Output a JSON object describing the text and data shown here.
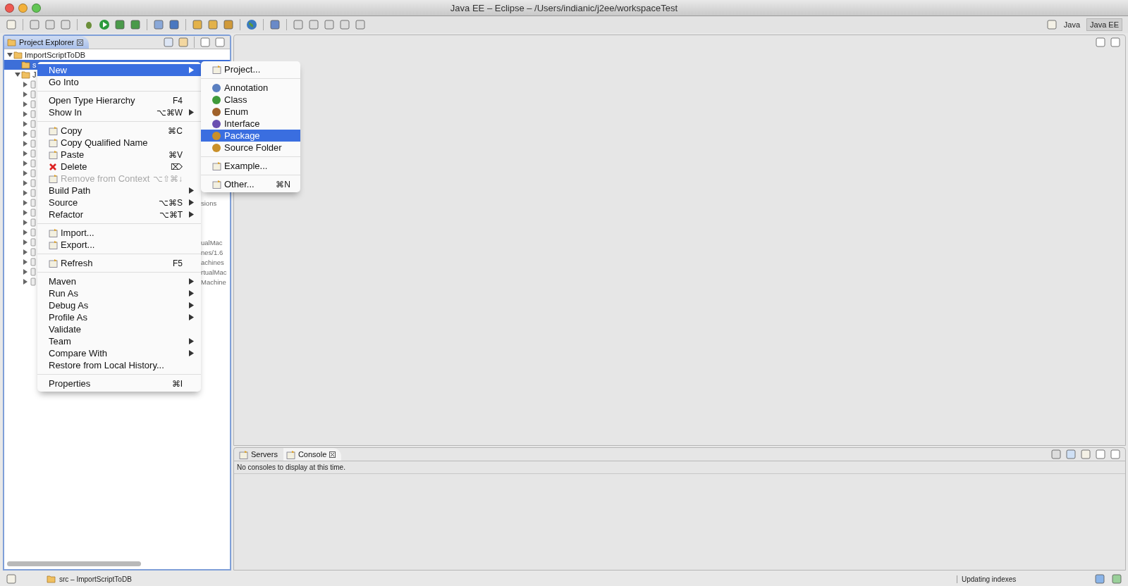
{
  "window": {
    "title": "Java EE – Eclipse – /Users/indianic/j2ee/workspaceTest"
  },
  "perspectives": [
    {
      "label": "Java",
      "selected": false
    },
    {
      "label": "Java EE",
      "selected": true
    }
  ],
  "project_explorer": {
    "tab": {
      "label": "Project Explorer",
      "selected": true
    },
    "tree": [
      {
        "label": "ImportScriptToDB",
        "expanded": true,
        "selected": false,
        "children": [
          {
            "label": "s",
            "selected": true
          },
          {
            "label": "J",
            "expanded": true,
            "selected": false,
            "children": [
              {
                "expanded": false
              },
              {
                "expanded": false
              },
              {
                "expanded": false
              },
              {
                "expanded": false
              },
              {
                "expanded": false
              },
              {
                "expanded": false
              },
              {
                "expanded": false
              },
              {
                "expanded": false
              },
              {
                "expanded": false
              },
              {
                "expanded": false
              },
              {
                "expanded": false
              },
              {
                "expanded": false
              },
              {
                "expanded": false,
                "label": "sions"
              },
              {
                "expanded": false
              },
              {
                "expanded": false
              },
              {
                "expanded": false
              },
              {
                "expanded": false,
                "label": "ualMac"
              },
              {
                "expanded": false,
                "label": "nes/1.6"
              },
              {
                "expanded": false,
                "label": "achines"
              },
              {
                "expanded": false,
                "label": "rtualMac"
              },
              {
                "expanded": false,
                "label": "Machine"
              }
            ]
          }
        ]
      }
    ]
  },
  "context_menu": {
    "items": [
      {
        "kind": "item",
        "label": "New",
        "submenu": true,
        "selected": true,
        "disabled": false
      },
      {
        "kind": "item",
        "label": "Go Into",
        "submenu": false,
        "selected": false,
        "disabled": false
      },
      {
        "kind": "separator"
      },
      {
        "kind": "item",
        "label": "Open Type Hierarchy",
        "shortcut": "F4",
        "submenu": false,
        "selected": false,
        "disabled": false
      },
      {
        "kind": "item",
        "label": "Show In",
        "shortcut": "⌥⌘W",
        "submenu": true,
        "selected": false,
        "disabled": false
      },
      {
        "kind": "separator"
      },
      {
        "kind": "icon-item",
        "label": "Copy",
        "shortcut": "⌘C",
        "submenu": false,
        "selected": false,
        "disabled": false
      },
      {
        "kind": "icon-item",
        "label": "Copy Qualified Name",
        "submenu": false,
        "selected": false,
        "disabled": false
      },
      {
        "kind": "icon-item",
        "label": "Paste",
        "shortcut": "⌘V",
        "submenu": false,
        "selected": false,
        "disabled": false
      },
      {
        "kind": "delete-item",
        "label": "Delete",
        "shortcut": "⌦",
        "submenu": false,
        "selected": false,
        "disabled": false
      },
      {
        "kind": "icon-item",
        "label": "Remove from Context",
        "shortcut": "⌥⇧⌘↓",
        "submenu": false,
        "selected": false,
        "disabled": true
      },
      {
        "kind": "item",
        "label": "Build Path",
        "submenu": true,
        "selected": false,
        "disabled": false
      },
      {
        "kind": "item",
        "label": "Source",
        "shortcut": "⌥⌘S",
        "submenu": true,
        "selected": false,
        "disabled": false
      },
      {
        "kind": "item",
        "label": "Refactor",
        "shortcut": "⌥⌘T",
        "submenu": true,
        "selected": false,
        "disabled": false
      },
      {
        "kind": "separator"
      },
      {
        "kind": "icon-item",
        "label": "Import...",
        "submenu": false,
        "selected": false,
        "disabled": false
      },
      {
        "kind": "icon-item",
        "label": "Export...",
        "submenu": false,
        "selected": false,
        "disabled": false
      },
      {
        "kind": "separator"
      },
      {
        "kind": "icon-item",
        "label": "Refresh",
        "shortcut": "F5",
        "submenu": false,
        "selected": false,
        "disabled": false
      },
      {
        "kind": "separator"
      },
      {
        "kind": "item",
        "label": "Maven",
        "submenu": true,
        "selected": false,
        "disabled": false
      },
      {
        "kind": "item",
        "label": "Run As",
        "submenu": true,
        "selected": false,
        "disabled": false
      },
      {
        "kind": "item",
        "label": "Debug As",
        "submenu": true,
        "selected": false,
        "disabled": false
      },
      {
        "kind": "item",
        "label": "Profile As",
        "submenu": true,
        "selected": false,
        "disabled": false
      },
      {
        "kind": "item",
        "label": "Validate",
        "submenu": false,
        "selected": false,
        "disabled": false
      },
      {
        "kind": "item",
        "label": "Team",
        "submenu": true,
        "selected": false,
        "disabled": false
      },
      {
        "kind": "item",
        "label": "Compare With",
        "submenu": true,
        "selected": false,
        "disabled": false
      },
      {
        "kind": "item",
        "label": "Restore from Local History...",
        "submenu": false,
        "selected": false,
        "disabled": false
      },
      {
        "kind": "separator"
      },
      {
        "kind": "item",
        "label": "Properties",
        "shortcut": "⌘I",
        "submenu": false,
        "selected": false,
        "disabled": false
      }
    ]
  },
  "new_submenu": {
    "items": [
      {
        "kind": "icon-item",
        "label": "Project...",
        "selected": false
      },
      {
        "kind": "separator"
      },
      {
        "kind": "icon-item",
        "label": "Annotation",
        "selected": false,
        "color": "#5a7fc0"
      },
      {
        "kind": "icon-item",
        "label": "Class",
        "selected": false,
        "color": "#3f9a3a"
      },
      {
        "kind": "icon-item",
        "label": "Enum",
        "selected": false,
        "color": "#a0622a"
      },
      {
        "kind": "icon-item",
        "label": "Interface",
        "selected": false,
        "color": "#6a4fb0"
      },
      {
        "kind": "icon-item",
        "label": "Package",
        "selected": true,
        "color": "#c9902a"
      },
      {
        "kind": "icon-item",
        "label": "Source Folder",
        "selected": false,
        "color": "#c9902a"
      },
      {
        "kind": "separator"
      },
      {
        "kind": "icon-item",
        "label": "Example...",
        "selected": false
      },
      {
        "kind": "separator"
      },
      {
        "kind": "icon-item",
        "label": "Other...",
        "shortcut": "⌘N",
        "selected": false
      }
    ]
  },
  "console_view": {
    "tabs": [
      {
        "label": "Servers",
        "selected": false
      },
      {
        "label": "Console",
        "selected": true
      }
    ],
    "message": "No consoles to display at this time."
  },
  "status_bar": {
    "selection": "src – ImportScriptToDB",
    "progress": "Updating indexes"
  }
}
